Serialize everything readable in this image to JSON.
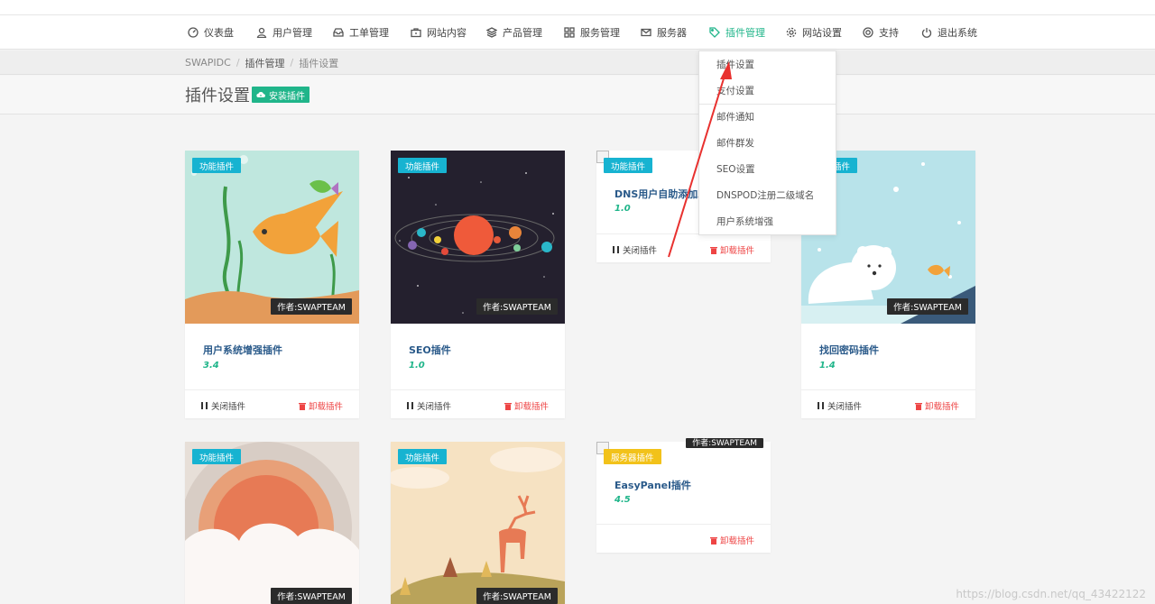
{
  "nav": {
    "items": [
      {
        "label": "仪表盘",
        "icon": "gauge-icon"
      },
      {
        "label": "用户管理",
        "icon": "user-icon"
      },
      {
        "label": "工单管理",
        "icon": "inbox-icon"
      },
      {
        "label": "网站内容",
        "icon": "briefcase-icon"
      },
      {
        "label": "产品管理",
        "icon": "layers-icon"
      },
      {
        "label": "服务管理",
        "icon": "grid-icon"
      },
      {
        "label": "服务器",
        "icon": "envelope-icon"
      },
      {
        "label": "插件管理",
        "icon": "tag-icon",
        "active": true
      },
      {
        "label": "网站设置",
        "icon": "gear-icon"
      },
      {
        "label": "支持",
        "icon": "lifebuoy-icon"
      },
      {
        "label": "退出系统",
        "icon": "power-icon"
      }
    ]
  },
  "breadcrumb": [
    "SWAPIDC",
    "插件管理",
    "插件设置"
  ],
  "page": {
    "title": "插件设置",
    "install_button": "安装插件"
  },
  "dropdown": {
    "items": [
      "插件设置",
      "支付设置",
      "邮件通知",
      "邮件群发",
      "SEO设置",
      "DNSPOD注册二级域名",
      "用户系统增强"
    ]
  },
  "actions": {
    "stop": "关闭插件",
    "uninstall": "卸载插件"
  },
  "plugins": [
    {
      "name": "用户系统增强插件",
      "version": "3.4",
      "tag": "功能插件",
      "author": "作者:SWAPTEAM"
    },
    {
      "name": "SEO插件",
      "version": "1.0",
      "tag": "功能插件",
      "author": "作者:SWAPTEAM"
    },
    {
      "name": "DNS用户自助添加二",
      "version": "1.0",
      "tag": "功能插件"
    },
    {
      "name": "找回密码插件",
      "version": "1.4",
      "tag": "功能插件",
      "author": "作者:SWAPTEAM"
    },
    {
      "tag": "功能插件",
      "author": "作者:SWAPTEAM"
    },
    {
      "tag": "功能插件",
      "author": "作者:SWAPTEAM"
    },
    {
      "name": "EasyPanel插件",
      "version": "4.5",
      "tag": "服务器插件",
      "author": "作者:SWAPTEAM"
    }
  ],
  "watermark": "https://blog.csdn.net/qq_43422122",
  "colors": {
    "accent": "#20b58a",
    "tag_blue": "#17b3d1",
    "tag_yellow": "#f2c21a",
    "danger": "#e44444",
    "arrow": "#e8312f"
  }
}
